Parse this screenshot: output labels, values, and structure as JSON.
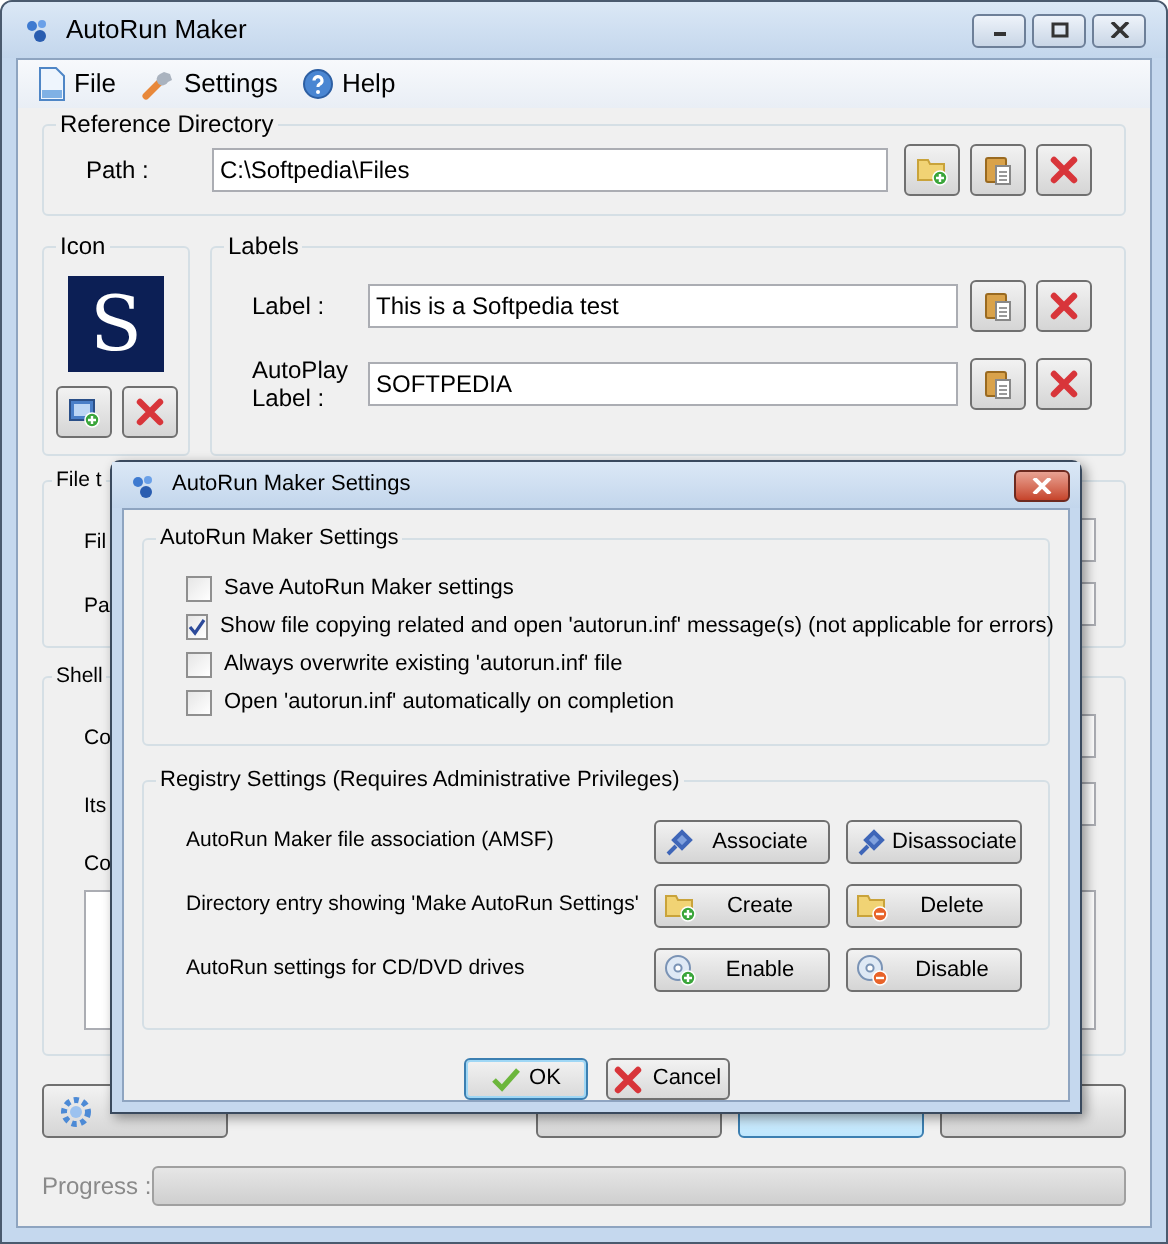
{
  "window": {
    "title": "AutoRun Maker"
  },
  "menu": [
    {
      "label": "File",
      "kind": "file"
    },
    {
      "label": "Settings",
      "kind": "settings"
    },
    {
      "label": "Help",
      "kind": "help"
    }
  ],
  "reference_directory": {
    "title": "Reference Directory",
    "path_label": "Path :",
    "path": "C:\\Softpedia\\Files"
  },
  "icon_group": {
    "title": "Icon",
    "letter": "S"
  },
  "labels": {
    "title": "Labels",
    "rows": [
      {
        "label": "Label :",
        "value": "This is a Softpedia test"
      },
      {
        "label": "AutoPlay Label :",
        "value": "SOFTPEDIA"
      }
    ]
  },
  "file_group": {
    "title": "File t",
    "rows": [
      "Fil",
      "Pa"
    ]
  },
  "shell_group": {
    "title": "Shell",
    "rows": [
      "Co",
      "Its"
    ],
    "list_label": "Co"
  },
  "progress": {
    "label": "Progress :",
    "level": 0
  },
  "dialog": {
    "title": "AutoRun Maker Settings",
    "settings": {
      "title": "AutoRun Maker Settings",
      "options": [
        {
          "label": "Save AutoRun Maker settings",
          "checked": false
        },
        {
          "label": "Show file copying related and open 'autorun.inf' message(s) (not applicable for errors)",
          "checked": true
        },
        {
          "label": "Always overwrite existing 'autorun.inf' file",
          "checked": false
        },
        {
          "label": "Open 'autorun.inf' automatically on completion",
          "checked": false
        }
      ]
    },
    "registry": {
      "title": "Registry Settings (Requires Administrative Privileges)",
      "rows": [
        {
          "label": "AutoRun Maker file association (AMSF)",
          "buttons": [
            {
              "label": "Associate",
              "kind": "plug-in"
            },
            {
              "label": "Disassociate",
              "kind": "plug-out"
            }
          ]
        },
        {
          "label": "Directory entry showing 'Make AutoRun Settings'",
          "buttons": [
            {
              "label": "Create",
              "kind": "folder-add"
            },
            {
              "label": "Delete",
              "kind": "folder-remove"
            }
          ]
        },
        {
          "label": "AutoRun settings for CD/DVD drives",
          "buttons": [
            {
              "label": "Enable",
              "kind": "disc-add"
            },
            {
              "label": "Disable",
              "kind": "disc-remove"
            }
          ]
        }
      ]
    },
    "buttons": [
      {
        "label": "OK",
        "kind": "ok",
        "selected": true
      },
      {
        "label": "Cancel",
        "kind": "cancel",
        "selected": false
      }
    ]
  }
}
